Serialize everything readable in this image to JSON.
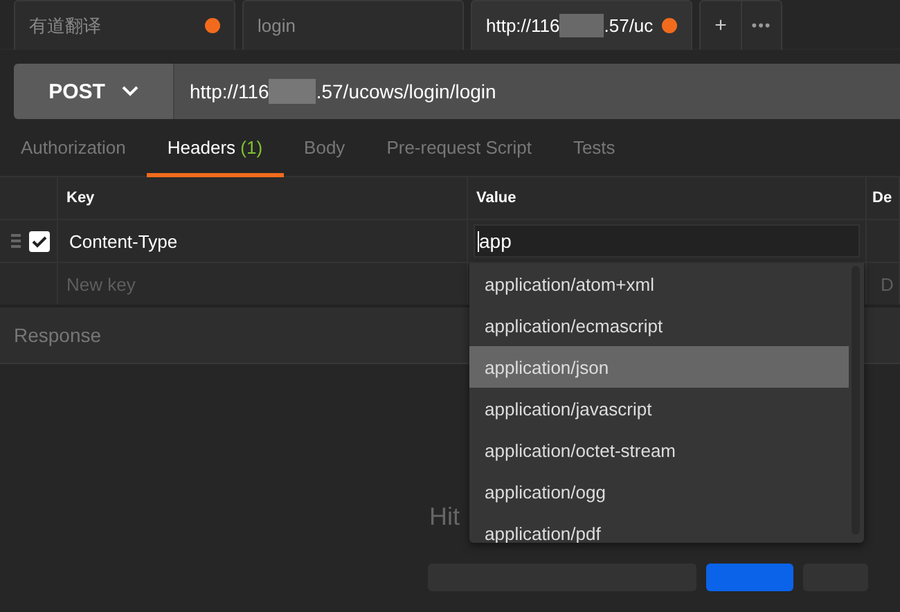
{
  "tabs": [
    {
      "title": "有道翻译",
      "unsaved": true,
      "selected": false
    },
    {
      "title": "login",
      "unsaved": false,
      "selected": false
    },
    {
      "title_start": "http://116",
      "title_end": ".57/uc",
      "unsaved": true,
      "selected": true
    }
  ],
  "tab_actions": [
    "+",
    "•••"
  ],
  "request": {
    "method": "POST",
    "url_start": "http://116",
    "url_end": ".57/ucows/login/login"
  },
  "subtabs": [
    {
      "label": "Authorization",
      "selected": false
    },
    {
      "label": "Headers",
      "count": "(1)",
      "selected": true
    },
    {
      "label": "Body",
      "selected": false
    },
    {
      "label": "Pre-request Script",
      "selected": false
    },
    {
      "label": "Tests",
      "selected": false
    }
  ],
  "headers_table": {
    "columns": [
      "Key",
      "Value",
      "De"
    ],
    "rows": [
      {
        "checked": true,
        "key": "Content-Type",
        "value": "app"
      }
    ],
    "new_row": {
      "key_placeholder": "New key",
      "column_3_placeholder": "D"
    }
  },
  "response": {
    "title": "Response",
    "hint": "Hit"
  },
  "autocomplete": [
    {
      "text": "application/atom+xml",
      "selected": false
    },
    {
      "text": "application/ecmascript",
      "selected": false
    },
    {
      "text": "application/json",
      "selected": true
    },
    {
      "text": "application/javascript",
      "selected": false
    },
    {
      "text": "application/octet-stream",
      "selected": false
    },
    {
      "text": "application/ogg",
      "selected": false
    },
    {
      "text": "application/pdf",
      "selected": false
    }
  ]
}
